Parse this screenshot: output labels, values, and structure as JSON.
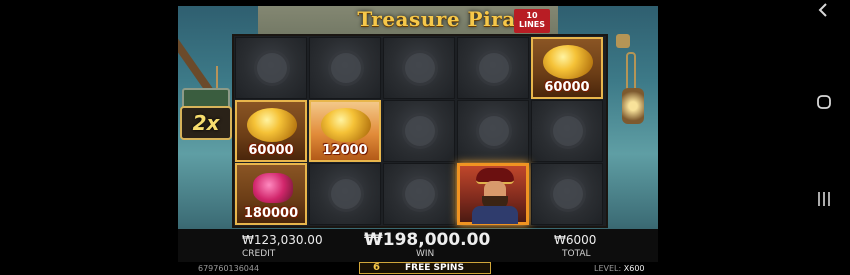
{
  "game": {
    "logo_title": "Treasure Pirate",
    "logo_lines": "10 LINES",
    "multiplier": "2x"
  },
  "reels": {
    "grid": [
      [
        {
          "type": "blank"
        },
        {
          "type": "blank"
        },
        {
          "type": "blank"
        },
        {
          "type": "blank"
        },
        {
          "type": "gold-sack",
          "value": "60000"
        }
      ],
      [
        {
          "type": "gold-sack",
          "value": "60000"
        },
        {
          "type": "gold-pile",
          "value": "12000"
        },
        {
          "type": "blank"
        },
        {
          "type": "blank"
        },
        {
          "type": "blank"
        }
      ],
      [
        {
          "type": "gem-barrel",
          "value": "180000"
        },
        {
          "type": "blank"
        },
        {
          "type": "blank"
        },
        {
          "type": "pirate"
        },
        {
          "type": "blank"
        }
      ]
    ]
  },
  "bottom_bar": {
    "credit_value": "₩123,030.00",
    "credit_label": "CREDIT",
    "win_value": "₩198,000.00",
    "win_label": "WIN",
    "total_value": "₩6000",
    "total_label": "TOTAL"
  },
  "footer": {
    "session_id": "679760136044",
    "free_spins_count": "6",
    "free_spins_label": "FREE SPINS",
    "level_label": "LEVEL:",
    "level_value": "X600"
  },
  "android_nav": {
    "back_icon": "chevron-left-icon",
    "home_icon": "circle-home-icon",
    "recents_icon": "recents-bars-icon"
  }
}
